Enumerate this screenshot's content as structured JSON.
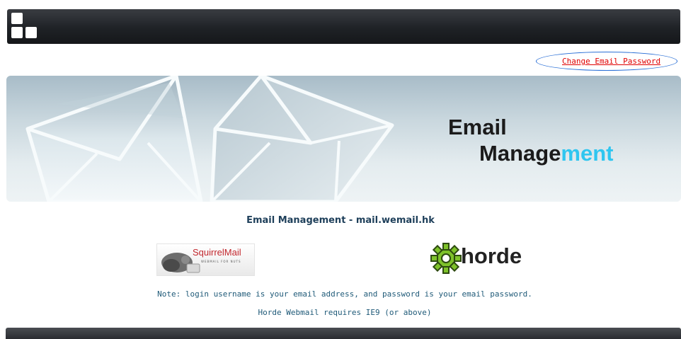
{
  "header": {
    "change_password_link": "Change Email Password"
  },
  "banner": {
    "line1": "Email",
    "line2_main": "Manage",
    "line2_highlight": "ment"
  },
  "main": {
    "title": "Email Management - mail.wemail.hk",
    "squirrelmail": {
      "name": "SquirrelMail",
      "tagline": "WEBMAIL FOR NUTS"
    },
    "horde": {
      "name": "horde"
    },
    "note": "Note: login username is your email address, and password is your email password.",
    "requirement": "Horde Webmail requires IE9 (or above)"
  },
  "colors": {
    "link": "#e00000",
    "highlight": "#2fc6f0",
    "title": "#1e3f5a",
    "note": "#1f5a78",
    "horde_gear": "#7ec22a"
  }
}
